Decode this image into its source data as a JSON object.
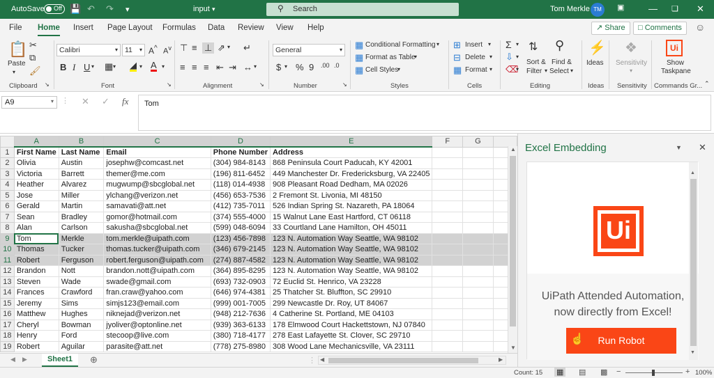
{
  "titlebar": {
    "autosave": "AutoSave",
    "toggle": "Off",
    "filename": "input",
    "search_placeholder": "Search",
    "user": "Tom Merkle",
    "initials": "TM"
  },
  "menu": {
    "tabs": [
      "File",
      "Home",
      "Insert",
      "Page Layout",
      "Formulas",
      "Data",
      "Review",
      "View",
      "Help"
    ],
    "share": "Share",
    "comments": "Comments"
  },
  "ribbon": {
    "clipboard": {
      "label": "Clipboard",
      "paste": "Paste"
    },
    "font": {
      "label": "Font",
      "name": "Calibri",
      "size": "11"
    },
    "alignment": {
      "label": "Alignment"
    },
    "number": {
      "label": "Number",
      "format": "General"
    },
    "styles": {
      "label": "Styles",
      "conditional": "Conditional Formatting",
      "format_table": "Format as Table",
      "cell_styles": "Cell Styles"
    },
    "cells": {
      "label": "Cells",
      "insert": "Insert",
      "delete": "Delete",
      "format": "Format"
    },
    "editing": {
      "label": "Editing",
      "sort": "Sort &",
      "filter": "Filter",
      "find": "Find &",
      "select": "Select"
    },
    "ideas": {
      "label": "Ideas",
      "button": "Ideas"
    },
    "sensitivity": {
      "label": "Sensitivity",
      "button": "Sensitivity"
    },
    "commands": {
      "label": "Commands Gr...",
      "show": "Show",
      "taskpane": "Taskpane"
    }
  },
  "formula_bar": {
    "cell_ref": "A9",
    "content": "Tom"
  },
  "sheet": {
    "col_headers": [
      "A",
      "B",
      "C",
      "D",
      "E",
      "F",
      "G"
    ],
    "rows": [
      [
        "First Name",
        "Last Name",
        "Email",
        "Phone Number",
        "Address"
      ],
      [
        "Olivia",
        "Austin",
        "josephw@comcast.net",
        "(304) 984-8143",
        "868 Peninsula Court Paducah, KY 42001"
      ],
      [
        "Victoria",
        "Barrett",
        "themer@me.com",
        "(196) 811-6452",
        "449 Manchester Dr. Fredericksburg, VA 22405"
      ],
      [
        "Heather",
        "Alvarez",
        "mugwump@sbcglobal.net",
        "(118) 014-4938",
        "908 Pleasant Road Dedham, MA 02026"
      ],
      [
        "Jose",
        "Miller",
        "ylchang@verizon.net",
        "(456) 653-7536",
        "2 Fremont St. Livonia, MI 48150"
      ],
      [
        "Gerald",
        "Martin",
        "samavati@att.net",
        "(412) 735-7011",
        "526 Indian Spring St. Nazareth, PA 18064"
      ],
      [
        "Sean",
        "Bradley",
        "gomor@hotmail.com",
        "(374) 555-4000",
        "15 Walnut Lane East Hartford, CT 06118"
      ],
      [
        "Alan",
        "Carlson",
        "sakusha@sbcglobal.net",
        "(599) 048-6094",
        "33 Courtland Lane Hamilton, OH 45011"
      ],
      [
        "Tom",
        "Merkle",
        "tom.merkle@uipath.com",
        "(123) 456-7898",
        "123 N. Automation Way Seattle, WA 98102"
      ],
      [
        "Thomas",
        "Tucker",
        "thomas.tucker@uipath.com",
        "(346) 679-2145",
        "123 N. Automation Way Seattle, WA 98102"
      ],
      [
        "Robert",
        "Ferguson",
        "robert.ferguson@uipath.com",
        "(274) 887-4582",
        "123 N. Automation Way Seattle, WA 98102"
      ],
      [
        "Brandon",
        "Nott",
        "brandon.nott@uipath.com",
        "(364) 895-8295",
        "123 N. Automation Way Seattle, WA 98102"
      ],
      [
        "Steven",
        "Wade",
        "swade@gmail.com",
        "(693) 732-0903",
        "72 Euclid St. Henrico, VA 23228"
      ],
      [
        "Frances",
        "Crawford",
        "fran.craw@yahoo.com",
        "(646) 974-4381",
        "25 Thatcher St. Bluffton, SC 29910"
      ],
      [
        "Jeremy",
        "Sims",
        "simjs123@email.com",
        "(999) 001-7005",
        "299 Newcastle Dr. Roy, UT 84067"
      ],
      [
        "Matthew",
        "Hughes",
        "niknejad@verizon.net",
        "(948) 212-7636",
        "4 Catherine St. Portland, ME 04103"
      ],
      [
        "Cheryl",
        "Bowman",
        "jyoliver@optonline.net",
        "(939) 363-6133",
        "178 Elmwood Court Hackettstown, NJ 07840"
      ],
      [
        "Henry",
        "Ford",
        "stecoop@live.com",
        "(380) 718-4177",
        "278 East Lafayette St. Clover, SC 29710"
      ],
      [
        "Robert",
        "Aguilar",
        "parasite@att.net",
        "(778) 275-8980",
        "308 Wood Lane Mechanicsville, VA 23111"
      ]
    ],
    "tab": "Sheet1"
  },
  "status": {
    "count": "Count: 15",
    "zoom": "100%"
  },
  "pane": {
    "title": "Excel Embedding",
    "logo": "Ui",
    "line1": "UiPath Attended Automation,",
    "line2": "now directly from Excel!",
    "button": "Run Robot"
  },
  "colors": {
    "excel_green": "#217346",
    "uipath_orange": "#fa4616"
  }
}
